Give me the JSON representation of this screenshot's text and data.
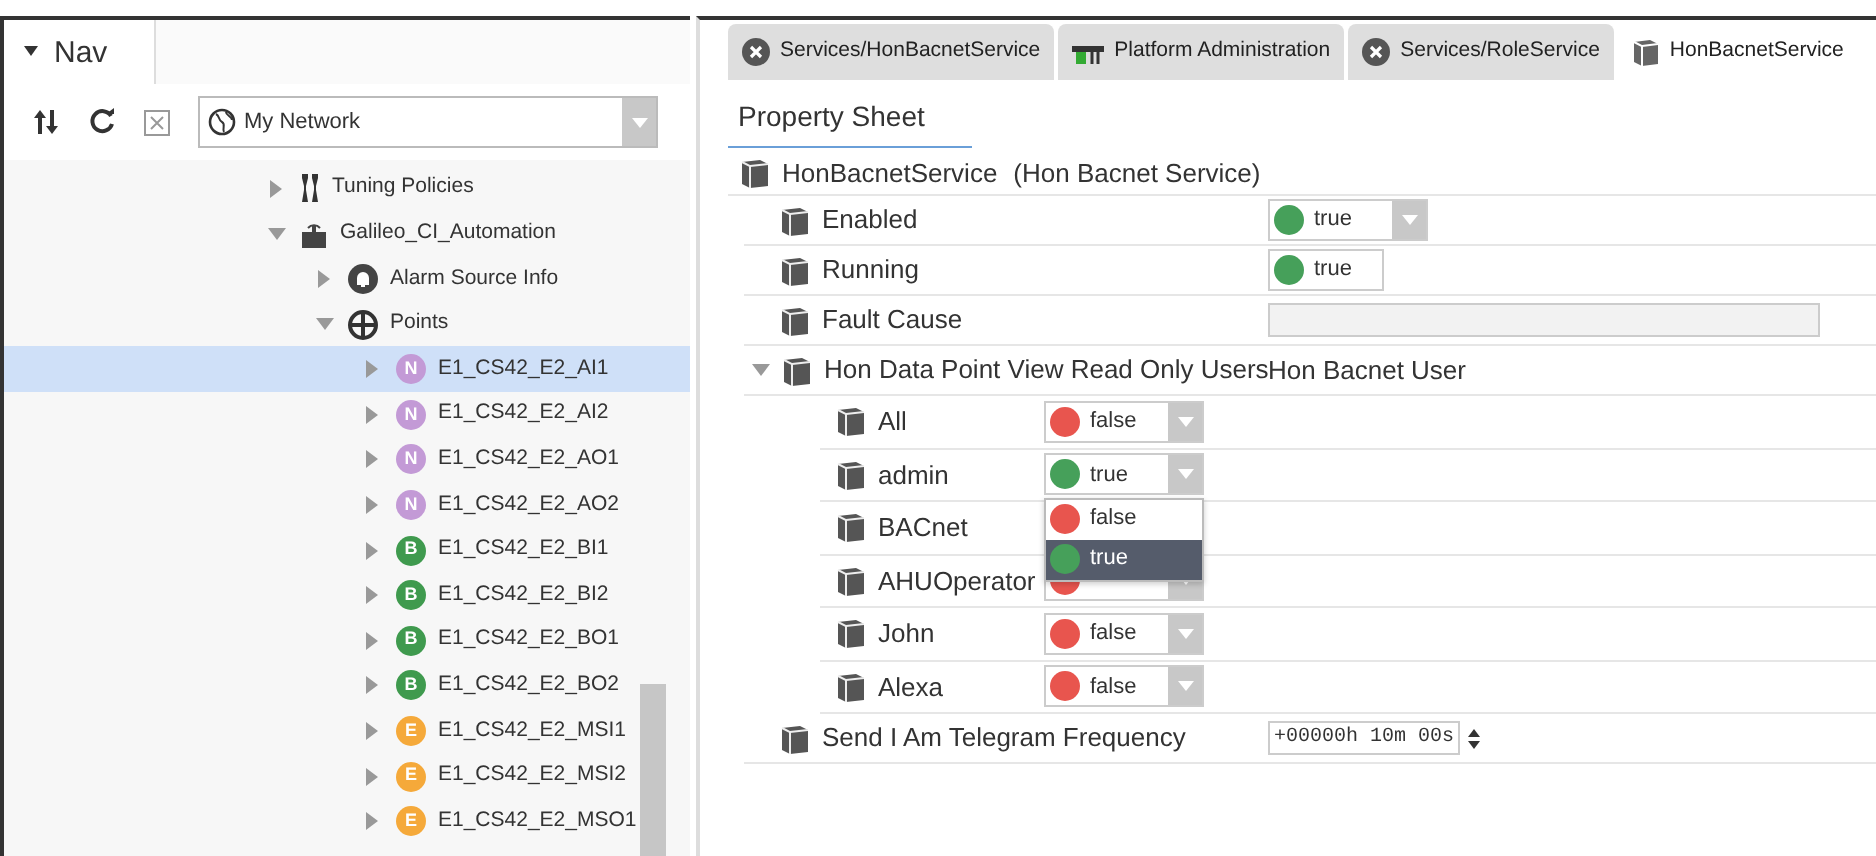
{
  "nav": {
    "title": "Nav",
    "network": "My Network",
    "tree": [
      {
        "label": "Tuning Policies",
        "kind": "tool",
        "expanded": false,
        "selected": false
      },
      {
        "label": "Galileo_CI_Automation",
        "kind": "device",
        "expanded": true,
        "selected": false,
        "children": [
          {
            "label": "Alarm Source Info",
            "kind": "alarm",
            "expanded": false,
            "selected": false
          },
          {
            "label": "Points",
            "kind": "folder",
            "expanded": true,
            "selected": false,
            "children": [
              {
                "label": "E1_CS42_E2_AI1",
                "badge": "N",
                "color": "#c39ad6",
                "expanded": false,
                "selected": true
              },
              {
                "label": "E1_CS42_E2_AI2",
                "badge": "N",
                "color": "#c39ad6",
                "expanded": false,
                "selected": false
              },
              {
                "label": "E1_CS42_E2_AO1",
                "badge": "N",
                "color": "#c39ad6",
                "expanded": false,
                "selected": false
              },
              {
                "label": "E1_CS42_E2_AO2",
                "badge": "N",
                "color": "#c39ad6",
                "expanded": false,
                "selected": false
              },
              {
                "label": "E1_CS42_E2_BI1",
                "badge": "B",
                "color": "#3f9a4e",
                "expanded": false,
                "selected": false
              },
              {
                "label": "E1_CS42_E2_BI2",
                "badge": "B",
                "color": "#3f9a4e",
                "expanded": false,
                "selected": false
              },
              {
                "label": "E1_CS42_E2_BO1",
                "badge": "B",
                "color": "#3f9a4e",
                "expanded": false,
                "selected": false
              },
              {
                "label": "E1_CS42_E2_BO2",
                "badge": "B",
                "color": "#3f9a4e",
                "expanded": false,
                "selected": false
              },
              {
                "label": "E1_CS42_E2_MSI1",
                "badge": "E",
                "color": "#f5a93a",
                "expanded": false,
                "selected": false
              },
              {
                "label": "E1_CS42_E2_MSI2",
                "badge": "E",
                "color": "#f5a93a",
                "expanded": false,
                "selected": false
              },
              {
                "label": "E1_CS42_E2_MSO1",
                "badge": "E",
                "color": "#f5a93a",
                "expanded": false,
                "selected": false
              }
            ]
          }
        ]
      }
    ]
  },
  "tabs": [
    {
      "label": "Services/HonBacnetService",
      "kind": "service",
      "selected": false
    },
    {
      "label": "Platform Administration",
      "kind": "platform",
      "selected": false
    },
    {
      "label": "Services/RoleService",
      "kind": "service",
      "selected": false
    },
    {
      "label": "HonBacnetService",
      "kind": "component",
      "selected": true
    }
  ],
  "view": {
    "title": "Property Sheet"
  },
  "properties": [
    {
      "kind": "header",
      "label": "HonBacnetService",
      "value": "(Hon Bacnet Service)"
    },
    {
      "kind": "boolean",
      "label": "Enabled",
      "value": "true",
      "on": true
    },
    {
      "kind": "readonly",
      "label": "Running",
      "value": "true",
      "on": true
    },
    {
      "kind": "field",
      "label": "Fault Cause"
    },
    {
      "kind": "group",
      "label": "Hon Data Point View Read Only Users",
      "value": "Hon Bacnet User",
      "expanded": true,
      "children": [
        {
          "kind": "boolean",
          "label": "All",
          "value": "false",
          "on": false
        },
        {
          "kind": "boolean",
          "label": "admin",
          "value": "true",
          "on": true,
          "menu": [
            {
              "label": "false",
              "on": false,
              "selected": false
            },
            {
              "label": "true",
              "on": true,
              "selected": true
            }
          ]
        },
        {
          "kind": "blank",
          "label": "BACnet"
        },
        {
          "kind": "covered",
          "label": "AHUOperator",
          "on": false
        },
        {
          "kind": "boolean",
          "label": "John",
          "value": "false",
          "on": false
        },
        {
          "kind": "boolean",
          "label": "Alexa",
          "value": "false",
          "on": false
        }
      ]
    },
    {
      "kind": "duration",
      "label": "Send I Am Telegram Frequency",
      "value": "+00000h 10m 00s"
    }
  ]
}
